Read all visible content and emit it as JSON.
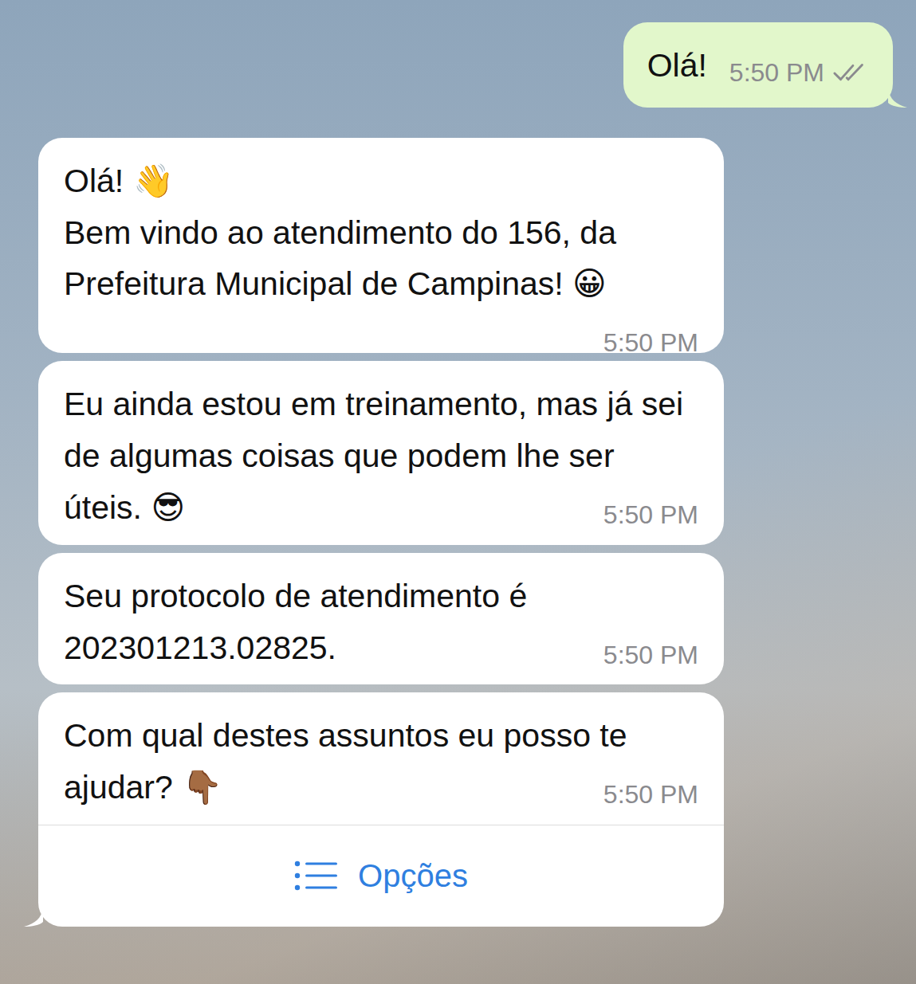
{
  "messages": [
    {
      "kind": "sent",
      "text": "Olá!",
      "time": "5:50 PM",
      "read": false
    },
    {
      "kind": "received",
      "text": "Olá! 👋\nBem vindo ao atendimento do 156, da Prefeitura Municipal de Campinas! 😀",
      "time": "5:50 PM"
    },
    {
      "kind": "received",
      "text": "Eu ainda estou em treinamento, mas já sei de algumas coisas que podem lhe ser úteis. 😎",
      "time": "5:50 PM"
    },
    {
      "kind": "received",
      "text": "Seu protocolo de atendimento é 202301213.02825.",
      "time": "5:50 PM"
    },
    {
      "kind": "received",
      "text": "Com qual destes assuntos eu posso te ajudar? 👇🏾",
      "time": "5:50 PM",
      "button": {
        "label": "Opções"
      }
    }
  ]
}
